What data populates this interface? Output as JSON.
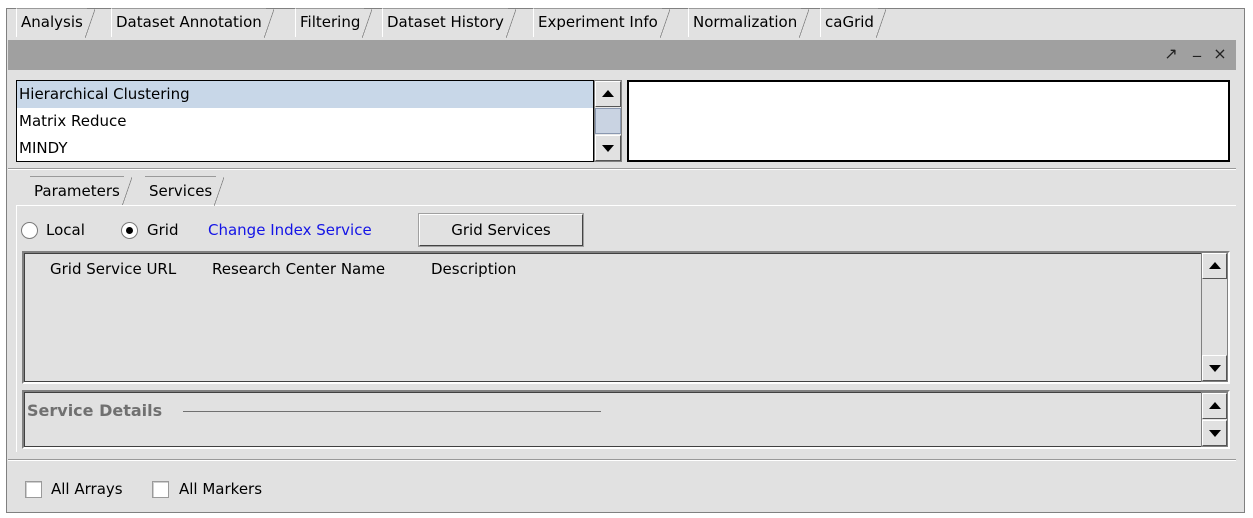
{
  "tabs": [
    "Analysis",
    "Dataset Annotation",
    "Filtering",
    "Dataset History",
    "Experiment Info",
    "Normalization",
    "caGrid"
  ],
  "window_controls": {
    "undock": "↗",
    "minimize": "_",
    "close": "×"
  },
  "algorithms": [
    "Hierarchical Clustering",
    "Matrix Reduce",
    "MINDY"
  ],
  "selected_algorithm": "Hierarchical Clustering",
  "subtabs": [
    "Parameters",
    "Services"
  ],
  "services": {
    "local_label": "Local",
    "grid_label": "Grid",
    "selected": "Grid",
    "change_index_link": "Change Index Service",
    "grid_services_button": "Grid Services",
    "columns": [
      "Grid Service URL",
      "Research Center Name",
      "Description"
    ],
    "details_title": "Service Details"
  },
  "footer": {
    "all_arrays": "All Arrays",
    "all_markers": "All Markers"
  }
}
